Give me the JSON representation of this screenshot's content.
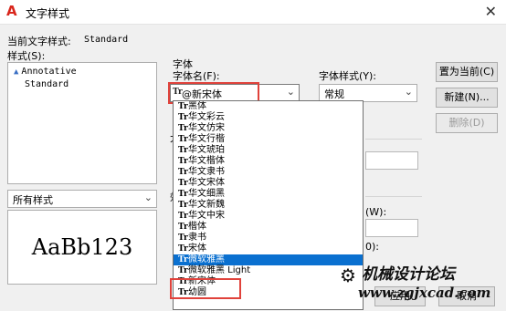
{
  "window": {
    "title": "文字样式",
    "app_icon_letter": "A",
    "close_glyph": "✕"
  },
  "current_style": {
    "label": "当前文字样式:",
    "value": "Standard"
  },
  "styles_label": "样式(S):",
  "styles": [
    {
      "name": "Annotative",
      "annotative": true
    },
    {
      "name": "Standard",
      "annotative": false
    }
  ],
  "filter": {
    "value": "所有样式"
  },
  "preview_text": "AaBb123",
  "font_group": {
    "title": "字体",
    "font_name_label": "字体名(F):",
    "font_name_value": "@新宋体",
    "font_style_label": "字体样式(Y):",
    "font_style_value": "常规"
  },
  "partial_labels": {
    "size_group": "大",
    "effects_group": "效",
    "width_suffix": "(W):",
    "angle_suffix": "0):"
  },
  "buttons": {
    "set_current": "置为当前(C)",
    "new": "新建(N)...",
    "delete": "删除(D)",
    "apply_partial": "应用",
    "close_partial": "取消"
  },
  "font_list": [
    "黑体",
    "华文彩云",
    "华文仿宋",
    "华文行楷",
    "华文琥珀",
    "华文楷体",
    "华文隶书",
    "华文宋体",
    "华文细黑",
    "华文新魏",
    "华文中宋",
    "楷体",
    "隶书",
    "宋体",
    "微软雅黑",
    "微软雅黑 Light",
    "新宋体",
    "幼圆"
  ],
  "font_list_selected": "微软雅黑",
  "font_icon": "Tr",
  "watermark": {
    "text": "机械设计论坛",
    "url": "www.zgjxcad.com"
  },
  "colors": {
    "accent_red": "#e0423b",
    "selection_blue": "#0a70d0",
    "app_red": "#d9261c"
  }
}
